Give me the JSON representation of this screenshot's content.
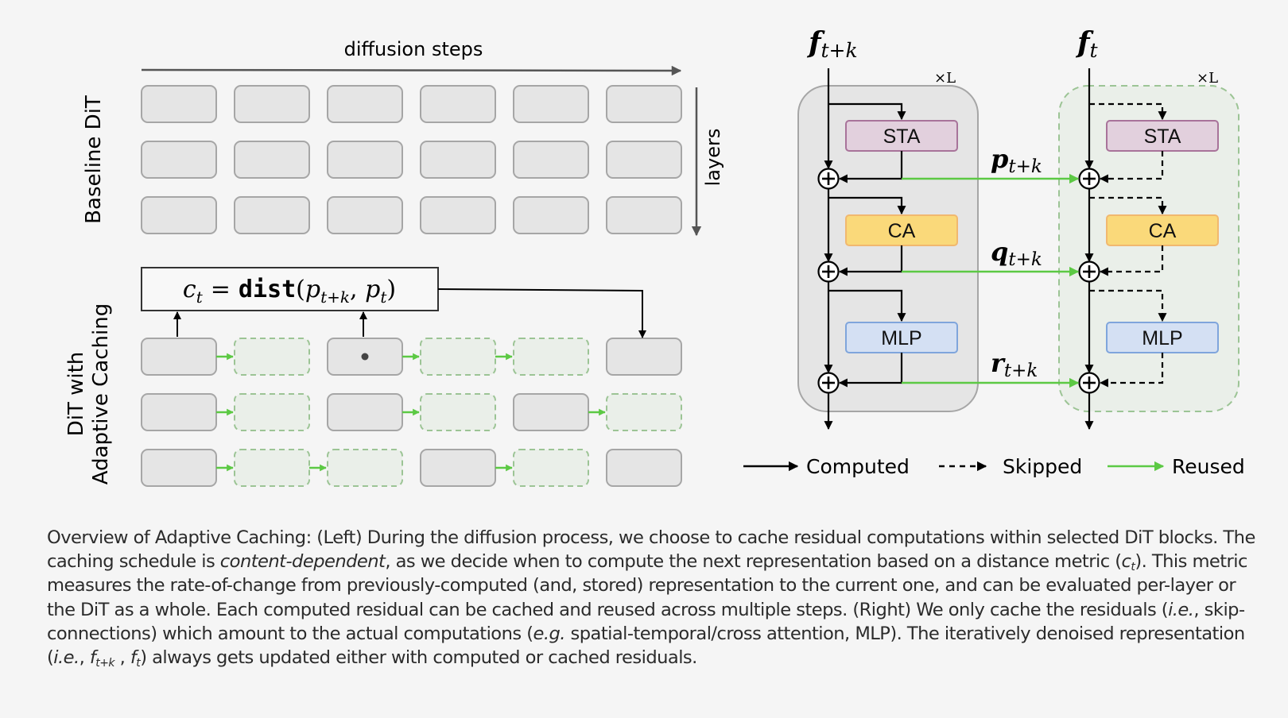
{
  "figure": {
    "left_panel": {
      "x_axis_label": "diffusion steps",
      "y_axis_label": "layers",
      "baseline_title": "Baseline DiT",
      "adaptive_title_line1": "DiT with",
      "adaptive_title_line2": "Adaptive Caching",
      "formula": {
        "lhs": "c",
        "lhs_sub": "t",
        "equals": "=",
        "func": "dist",
        "arg1": "p",
        "arg1_sub": "t+k",
        "arg2": "p",
        "arg2_sub": "t"
      },
      "grid_columns": 6,
      "grid_rows": 3,
      "baseline_grid": [
        [
          "computed",
          "computed",
          "computed",
          "computed",
          "computed",
          "computed"
        ],
        [
          "computed",
          "computed",
          "computed",
          "computed",
          "computed",
          "computed"
        ],
        [
          "computed",
          "computed",
          "computed",
          "computed",
          "computed",
          "computed"
        ]
      ],
      "adaptive_grid": [
        [
          "computed",
          "cached",
          "computed",
          "cached",
          "cached",
          "computed"
        ],
        [
          "computed",
          "cached",
          "computed",
          "cached",
          "computed",
          "cached"
        ],
        [
          "computed",
          "cached",
          "cached",
          "computed",
          "cached",
          "computed"
        ]
      ],
      "marked_block": {
        "row": 0,
        "col": 2
      }
    },
    "right_panel": {
      "left_stream_label": "f",
      "left_stream_sub": "t+k",
      "right_stream_label": "f",
      "right_stream_sub": "t",
      "repeat_label": "×L",
      "blocks": [
        {
          "name": "STA",
          "fill": "#e2d0dd",
          "stroke": "#a8739a",
          "residual": "p",
          "residual_sub": "t+k"
        },
        {
          "name": "CA",
          "fill": "#fad97a",
          "stroke": "#f1b86f",
          "residual": "q",
          "residual_sub": "t+k"
        },
        {
          "name": "MLP",
          "fill": "#d4e0f3",
          "stroke": "#7fa5dc",
          "residual": "r",
          "residual_sub": "t+k"
        }
      ]
    },
    "legend": [
      {
        "label": "Computed",
        "style": "solid",
        "color": "#000000"
      },
      {
        "label": "Skipped",
        "style": "dashed",
        "color": "#000000"
      },
      {
        "label": "Reused",
        "style": "solid",
        "color": "#5cc944"
      }
    ],
    "colors": {
      "background": "#f5f5f5",
      "computed_block_fill": "#e5e5e5",
      "computed_block_stroke": "#a6a6a6",
      "cached_block_fill": "#eaefe9",
      "cached_block_stroke": "#9cc495",
      "reuse_arrow": "#5cc944",
      "axis_arrow": "#555555"
    }
  },
  "caption": {
    "s1": "Overview of Adaptive Caching: (Left) During the diffusion process, we choose to cache residual computations within selected DiT blocks. The caching schedule is ",
    "s1_em": "content-dependent",
    "s2": ", as we decide when to compute the next representation based on a distance metric (",
    "s2_var": "c",
    "s2_var_sub": "t",
    "s3": "). This metric measures the rate-of-change from previously-computed (and, stored) representation to the current one, and can be evaluated per-layer or the DiT as a whole. Each computed residual can be cached and reused across multiple steps. (Right) We only cache the residuals (",
    "s3_em": "i.e.",
    "s4": ", skip-connections) which amount to the actual computations (",
    "s4_em": "e.g.",
    "s5": " spatial-temporal/cross attention, MLP). The iteratively denoised representation (",
    "s5_em": "i.e.",
    "s6": ", ",
    "s6_var1": "f",
    "s6_var1_sub": "t+k",
    "s6_sep": " , ",
    "s6_var2": "f",
    "s6_var2_sub": "t",
    "s7": ") always gets updated either with computed or cached residuals."
  }
}
